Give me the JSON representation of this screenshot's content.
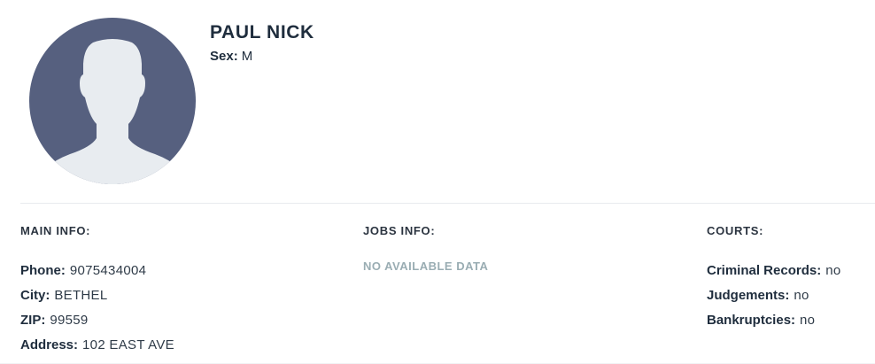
{
  "profile": {
    "name": "PAUL NICK",
    "sex_label": "Sex:",
    "sex_value": "M",
    "avatar_icon": "person-silhouette-icon"
  },
  "main_info": {
    "title": "MAIN INFO:",
    "fields": [
      {
        "label": "Phone:",
        "value": "9075434004"
      },
      {
        "label": "City:",
        "value": "BETHEL"
      },
      {
        "label": "ZIP:",
        "value": "99559"
      },
      {
        "label": "Address:",
        "value": "102 EAST AVE"
      }
    ]
  },
  "jobs_info": {
    "title": "JOBS INFO:",
    "empty_text": "NO AVAILABLE DATA"
  },
  "courts": {
    "title": "COURTS:",
    "fields": [
      {
        "label": "Criminal Records:",
        "value": "no"
      },
      {
        "label": "Judgements:",
        "value": "no"
      },
      {
        "label": "Bankruptcies:",
        "value": "no"
      }
    ]
  },
  "colors": {
    "avatar_bg": "#56607f",
    "avatar_figure": "#e8ecf0",
    "no_data_text": "#9aadb3"
  }
}
